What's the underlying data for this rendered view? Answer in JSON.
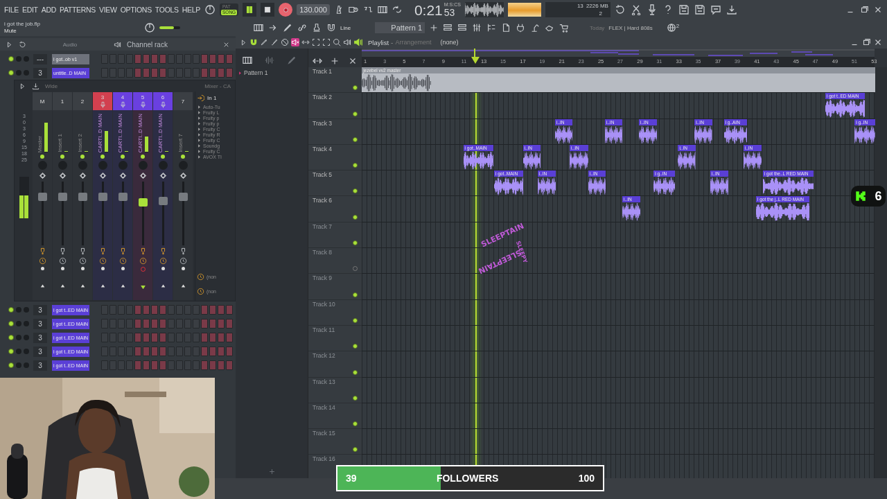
{
  "menu": [
    "FILE",
    "EDIT",
    "ADD",
    "PATTERNS",
    "VIEW",
    "OPTIONS",
    "TOOLS",
    "HELP"
  ],
  "project": {
    "file": "i got the job.flp",
    "hint": "Mute"
  },
  "transport": {
    "pat": "PAT",
    "song": "SONG",
    "song_mode": true,
    "playing": true,
    "tempo": "130.000",
    "pitch": {
      "level": 0.7
    }
  },
  "clock": {
    "time": "0:21",
    "centis": "53",
    "unit": "M:S:CS"
  },
  "cpu": {
    "voices": "13",
    "memory": "2226 MB",
    "polyphony": "2"
  },
  "toolbar": {
    "snap": "Line",
    "pattern": "Pattern 1",
    "news_date": "Today",
    "news": "FLEX | Hard 808s",
    "notifications": "2"
  },
  "channel_rack": {
    "filter": "Audio",
    "title": "Channel rack",
    "channels": [
      {
        "number": "---",
        "name": "i got..ob v1",
        "color": "#6e727b"
      },
      {
        "number": "3",
        "name": "untitle..D MAIN",
        "color": "#5a3fd6"
      },
      {
        "number": "3",
        "name": "i got t..ED MAIN",
        "color": "#5a3fd6"
      },
      {
        "number": "3",
        "name": "i got t..ED MAIN",
        "color": "#5a3fd6"
      },
      {
        "number": "3",
        "name": "i got t..ED MAIN",
        "color": "#5a3fd6"
      },
      {
        "number": "3",
        "name": "i got t..ED MAIN",
        "color": "#5a3fd6"
      },
      {
        "number": "3",
        "name": "i got t..ED MAIN",
        "color": "#5a3fd6"
      }
    ]
  },
  "mixer": {
    "preset": "Wide",
    "title": "Mixer - CA",
    "scale": [
      "3",
      "0",
      "3",
      "6",
      "9",
      "15",
      "18",
      "25"
    ],
    "peak": {
      "level": 0.55
    },
    "strips": [
      {
        "number": "M",
        "name": "Master",
        "selected": false,
        "fx_on": true,
        "armed": false,
        "meter": {
          "level": 0.85
        },
        "fader": {
          "level": 0.8
        }
      },
      {
        "number": "1",
        "name": "Insert 1",
        "selected": false,
        "fx_on": false,
        "armed": false,
        "meter": {
          "level": 0
        },
        "fader": {
          "level": 0.8
        }
      },
      {
        "number": "2",
        "name": "Insert 2",
        "selected": false,
        "fx_on": false,
        "armed": false,
        "meter": {
          "level": 0
        },
        "fader": {
          "level": 0.8
        }
      },
      {
        "number": "3",
        "name": "CARTI..D MAIN",
        "color": "#d2404f",
        "selected": false,
        "fx_on": true,
        "armed": false,
        "meter": {
          "level": 0.6
        },
        "fader": {
          "level": 0.8
        }
      },
      {
        "number": "4",
        "name": "CARTI..D MAIN",
        "color": "#6a40e0",
        "selected": false,
        "fx_on": true,
        "armed": false,
        "meter": {
          "level": 0
        },
        "fader": {
          "level": 0.8
        }
      },
      {
        "number": "5",
        "name": "CARTI..D MAIN",
        "color": "#6a40e0",
        "selected": true,
        "fx_on": true,
        "armed": true,
        "meter": {
          "level": 0.45
        },
        "fader": {
          "level": 0.7
        }
      },
      {
        "number": "6",
        "name": "CARTI..D MAIN",
        "color": "#6a40e0",
        "selected": false,
        "fx_on": true,
        "armed": false,
        "meter": {
          "level": 0
        },
        "fader": {
          "level": 0.72
        }
      },
      {
        "number": "7",
        "name": "Insert 7",
        "selected": false,
        "fx_on": false,
        "armed": false,
        "meter": {
          "level": 0
        },
        "fader": {
          "level": 0.8
        }
      }
    ],
    "input": "In 1",
    "plugins": [
      "Auto-Tu",
      "Fruity L",
      "Fruity p",
      "Fruity p",
      "Fruity C",
      "Fruity R",
      "Fruity C",
      "Soundg",
      "Fruity C",
      "AVOX TI"
    ],
    "slots": [
      "(non",
      "(non"
    ]
  },
  "playlist": {
    "title": "Playlist",
    "separator": "-",
    "view": "Arrangement",
    "pattern": "(none)",
    "tools": [
      {
        "selected": false
      },
      {
        "selected": false
      },
      {
        "selected": false
      },
      {
        "selected": false
      },
      {
        "selected": true
      },
      {
        "selected": false
      },
      {
        "selected": false
      },
      {
        "selected": false
      },
      {
        "selected": false
      },
      {
        "selected": false
      }
    ],
    "browser": [
      "Pattern 1"
    ],
    "ruler": [
      "1",
      "3",
      "5",
      "7",
      "9",
      "11",
      "13",
      "15",
      "17",
      "19",
      "21",
      "23",
      "25",
      "27",
      "29",
      "31",
      "33",
      "35",
      "37",
      "39",
      "41",
      "43",
      "45",
      "47",
      "49",
      "51",
      "53"
    ],
    "tracks": [
      {
        "name": "Track 1",
        "enabled": true,
        "clips": [
          {
            "label": "jezebel vv2 master",
            "kind": "full"
          }
        ]
      },
      {
        "name": "Track 2",
        "enabled": true,
        "clips": [
          {
            "label": "i got t..ED MAIN",
            "kind": "audio"
          }
        ]
      },
      {
        "name": "Track 3",
        "enabled": true,
        "clips": [
          {
            "label": "i..IN",
            "kind": "audio"
          },
          {
            "label": "i..IN",
            "kind": "audio"
          },
          {
            "label": "i..IN",
            "kind": "audio"
          },
          {
            "label": "i..IN",
            "kind": "audio"
          },
          {
            "label": "i g..AIN",
            "kind": "audio"
          },
          {
            "label": "i g..IN",
            "kind": "audio"
          }
        ]
      },
      {
        "name": "Track 4",
        "enabled": true,
        "clips": [
          {
            "label": "i got..MAIN",
            "kind": "audio"
          },
          {
            "label": "i..IN",
            "kind": "audio"
          },
          {
            "label": "i..IN",
            "kind": "audio"
          },
          {
            "label": "i..IN",
            "kind": "audio"
          },
          {
            "label": "i..IN",
            "kind": "audio"
          }
        ]
      },
      {
        "name": "Track 5",
        "enabled": true,
        "clips": [
          {
            "label": "i got..MAIN",
            "kind": "audio"
          },
          {
            "label": "i..IN",
            "kind": "audio"
          },
          {
            "label": "i..IN",
            "kind": "audio"
          },
          {
            "label": "i g..IN",
            "kind": "audio"
          },
          {
            "label": "i..IN",
            "kind": "audio"
          },
          {
            "label": "i got the..L RED MAIN",
            "kind": "audio"
          }
        ]
      },
      {
        "name": "Track 6",
        "enabled": true,
        "clips": [
          {
            "label": "i..IN",
            "kind": "audio"
          },
          {
            "label": "i got the j..L RED MAIN",
            "kind": "audio"
          }
        ]
      },
      {
        "name": "Track 7",
        "enabled": true
      },
      {
        "name": "Track 8",
        "enabled": false
      },
      {
        "name": "Track 9",
        "enabled": true
      },
      {
        "name": "Track 10",
        "enabled": true
      },
      {
        "name": "Track 11",
        "enabled": true
      },
      {
        "name": "Track 12",
        "enabled": true
      },
      {
        "name": "Track 13",
        "enabled": true
      },
      {
        "name": "Track 14",
        "enabled": true
      },
      {
        "name": "Track 15",
        "enabled": true
      },
      {
        "name": "Track 16"
      }
    ]
  },
  "sticker": {
    "words": [
      "SLEEPTAIN",
      "SLEEPY",
      "SLEEPTAIN"
    ]
  },
  "kick_badge": {
    "count": "6"
  },
  "followers": {
    "count": "39",
    "label": "FOLLOWERS",
    "goal": "100",
    "level": 0.39
  }
}
